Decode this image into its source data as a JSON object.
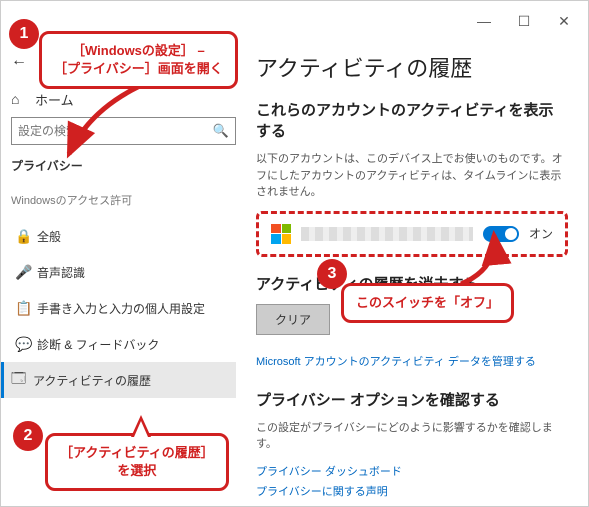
{
  "window": {
    "minimize": "—",
    "maximize": "☐",
    "close": "✕"
  },
  "sidebar": {
    "back": "←",
    "home_icon": "⌂",
    "home_label": "ホーム",
    "search_placeholder": "設定の検索",
    "section": "プライバシー",
    "perm_header": "Windowsのアクセス許可",
    "items": [
      {
        "icon": "🔒",
        "label": "全般"
      },
      {
        "icon": "🎤",
        "label": "音声認識"
      },
      {
        "icon": "📋",
        "label": "手書き入力と入力の個人用設定"
      },
      {
        "icon": "💬",
        "label": "診断 & フィードバック"
      },
      {
        "icon": "🗔",
        "label": "アクティビティの履歴"
      }
    ]
  },
  "main": {
    "title": "アクティビティの履歴",
    "show_heading": "これらのアカウントのアクティビティを表示する",
    "show_desc": "以下のアカウントは、このデバイス上でお使いのものです。オフにしたアカウントのアクティビティは、タイムラインに表示されません。",
    "toggle_label": "オン",
    "clear_heading": "アクティビティの履歴を消去する",
    "clear_button": "クリア",
    "manage_link": "Microsoft アカウントのアクティビティ データを管理する",
    "options_heading": "プライバシー オプションを確認する",
    "options_desc": "この設定がプライバシーにどのように影響するかを確認します。",
    "link1": "プライバシー ダッシュボード",
    "link2": "プライバシーに関する声明"
  },
  "callouts": {
    "c1": "［Windowsの設定］ –\n［プライバシー］画面を開く",
    "c2": "［アクティビティの履歴］\nを選択",
    "c3": "このスイッチを「オフ」",
    "n1": "1",
    "n2": "2",
    "n3": "3"
  }
}
